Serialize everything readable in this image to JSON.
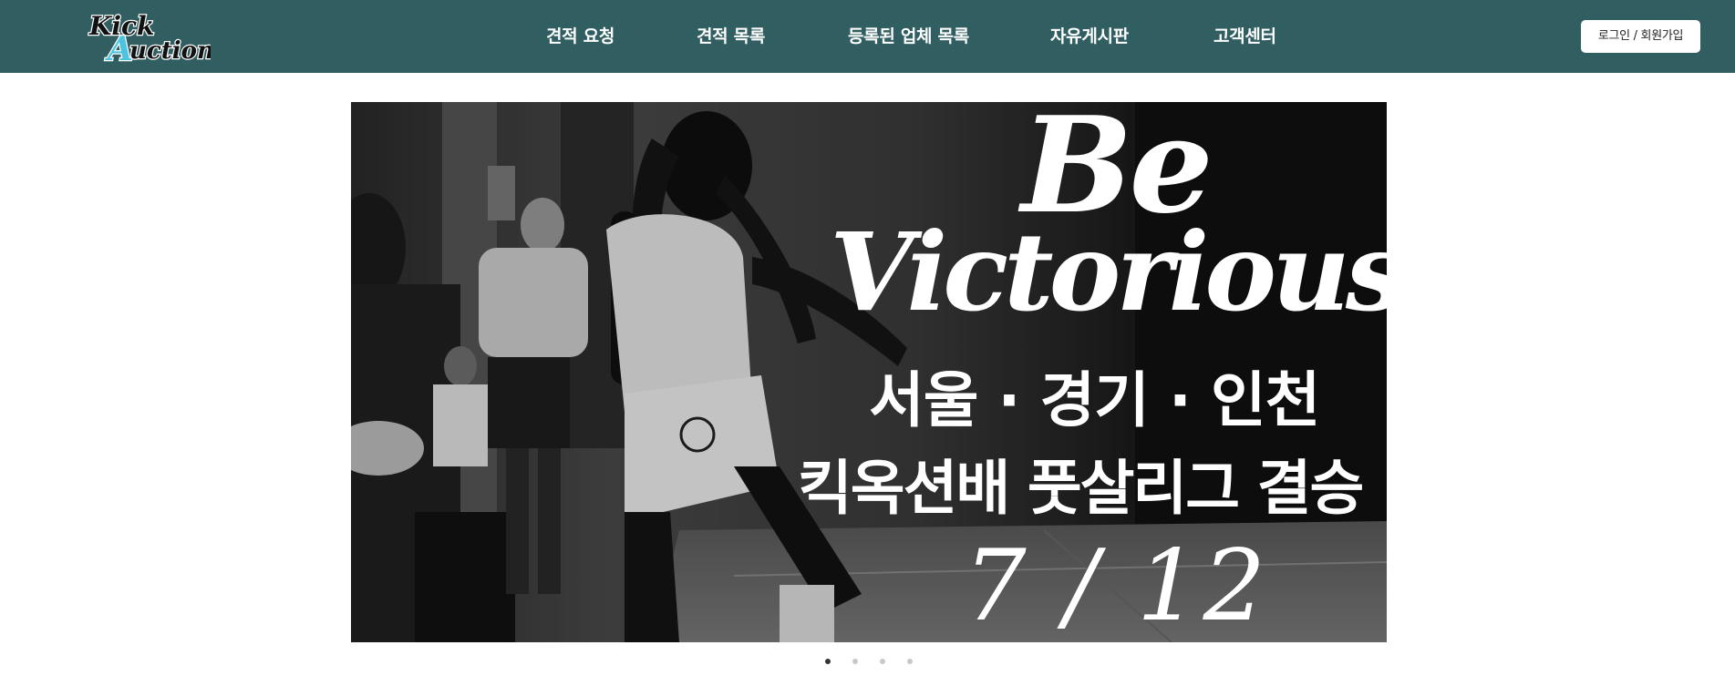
{
  "brand": {
    "logo_text_line1": "Kick",
    "logo_text_line2": "Auction",
    "accent_color": "#4ec3e0",
    "header_color": "#305e61"
  },
  "nav": {
    "items": [
      {
        "label": "견적 요청"
      },
      {
        "label": "견적 목록"
      },
      {
        "label": "등록된 업체 목록"
      },
      {
        "label": "자유게시판"
      },
      {
        "label": "고객센터"
      }
    ]
  },
  "auth": {
    "login_label": "로그인 / 회원가입"
  },
  "banner": {
    "headline_line1": "Be",
    "headline_line2": "Victorious",
    "region": "서울 · 경기 · 인천",
    "event": "킥옥션배 풋살리그 결승",
    "date": "7 / 12"
  },
  "carousel": {
    "slide_count": 4,
    "active_index": 0
  }
}
